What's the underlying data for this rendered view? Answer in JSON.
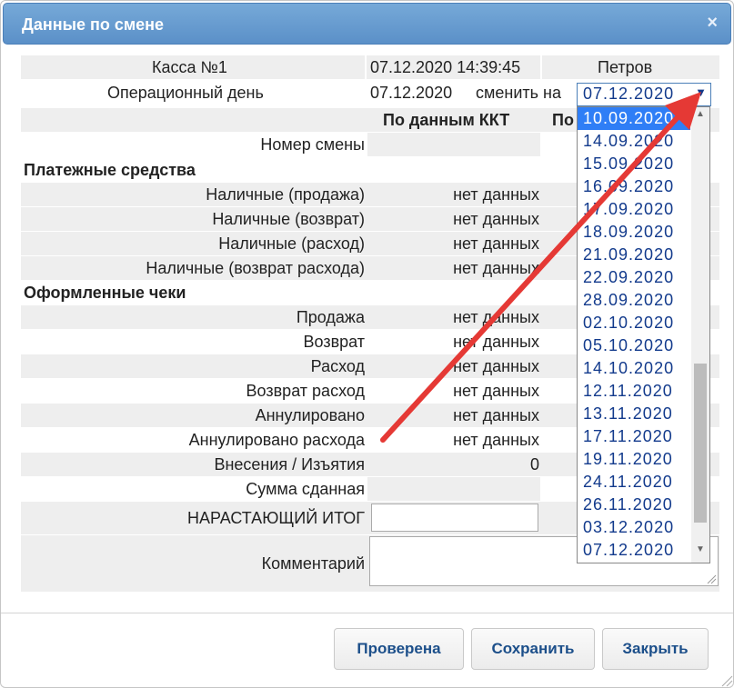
{
  "dialog": {
    "title": "Данные по смене",
    "close_glyph": "×"
  },
  "info": {
    "kassa": "Касса №1",
    "datetime": "07.12.2020 14:39:45",
    "user": "Петров",
    "op_day_label": "Операционный день",
    "op_day_value": "07.12.2020",
    "change_label": "сменить на",
    "selected_date": "07.12.2020"
  },
  "headers": {
    "kkt": "По данным ККТ",
    "po": "По"
  },
  "rows": {
    "shift_number": "Номер смены",
    "payments_section": "Платежные средства",
    "cash_sale": "Наличные (продажа)",
    "cash_return": "Наличные (возврат)",
    "cash_expense": "Наличные (расход)",
    "cash_expense_return": "Наличные (возврат расхода)",
    "receipts_section": "Оформленные чеки",
    "sale": "Продажа",
    "return": "Возврат",
    "expense": "Расход",
    "expense_return": "Возврат расход",
    "cancelled": "Аннулировано",
    "cancelled_expense": "Аннулировано расхода",
    "deposits": "Внесения / Изъятия",
    "amount_handed": "Сумма сданная",
    "running_total": "НАРАСТАЮЩИЙ ИТОГ",
    "comment": "Комментарий"
  },
  "values": {
    "no_data": "нет данных",
    "deposits_value": "0"
  },
  "dropdown": {
    "options": [
      "10.09.2020",
      "14.09.2020",
      "15.09.2020",
      "16.09.2020",
      "17.09.2020",
      "18.09.2020",
      "21.09.2020",
      "22.09.2020",
      "28.09.2020",
      "02.10.2020",
      "05.10.2020",
      "14.10.2020",
      "12.11.2020",
      "13.11.2020",
      "17.11.2020",
      "19.11.2020",
      "24.11.2020",
      "26.11.2020",
      "03.12.2020",
      "07.12.2020"
    ],
    "highlighted": "10.09.2020"
  },
  "buttons": {
    "checked": "Проверена",
    "save": "Сохранить",
    "close": "Закрыть"
  },
  "colors": {
    "title_bar": "#5b90c8",
    "annotation_arrow": "#e53935",
    "highlight": "#2f7ef6",
    "button_text": "#1c4f8a"
  },
  "icons": {
    "close": "close-icon",
    "dropdown": "chevron-down-icon",
    "resize": "resize-grip-icon"
  }
}
